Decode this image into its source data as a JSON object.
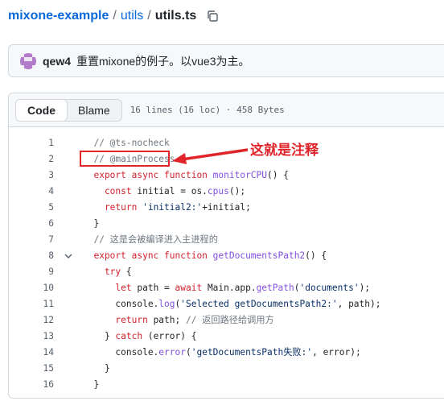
{
  "breadcrumb": {
    "repo": "mixone-example",
    "sep1": "/",
    "folder": "utils",
    "sep2": "/",
    "file": "utils.ts"
  },
  "commit": {
    "author": "qew4",
    "message": "重置mixone的例子。以vue3为主。"
  },
  "file_header": {
    "tab_code": "Code",
    "tab_blame": "Blame",
    "meta": "16 lines (16 loc) · 458 Bytes"
  },
  "code_lines": [
    {
      "n": "1",
      "tokens": [
        {
          "t": "  // @ts-nocheck",
          "c": "c"
        }
      ]
    },
    {
      "n": "2",
      "tokens": [
        {
          "t": "  // @mainProcess",
          "c": "c"
        }
      ]
    },
    {
      "n": "3",
      "tokens": [
        {
          "t": "  export async function ",
          "c": "k"
        },
        {
          "t": "monitorCPU",
          "c": "f"
        },
        {
          "t": "() {",
          "c": "v"
        }
      ]
    },
    {
      "n": "4",
      "tokens": [
        {
          "t": "    const ",
          "c": "k"
        },
        {
          "t": "initial = os.",
          "c": "v"
        },
        {
          "t": "cpus",
          "c": "f"
        },
        {
          "t": "();",
          "c": "v"
        }
      ]
    },
    {
      "n": "5",
      "tokens": [
        {
          "t": "    return ",
          "c": "k"
        },
        {
          "t": "'initial2:'",
          "c": "s"
        },
        {
          "t": "+initial;",
          "c": "v"
        }
      ]
    },
    {
      "n": "6",
      "tokens": [
        {
          "t": "  }",
          "c": "v"
        }
      ]
    },
    {
      "n": "7",
      "tokens": [
        {
          "t": "  // 这是会被编译进入主进程的",
          "c": "c"
        }
      ]
    },
    {
      "n": "8",
      "fold": true,
      "tokens": [
        {
          "t": "  export async function ",
          "c": "k"
        },
        {
          "t": "getDocumentsPath2",
          "c": "f"
        },
        {
          "t": "() {",
          "c": "v"
        }
      ]
    },
    {
      "n": "9",
      "tokens": [
        {
          "t": "    try ",
          "c": "k"
        },
        {
          "t": "{",
          "c": "v"
        }
      ]
    },
    {
      "n": "10",
      "tokens": [
        {
          "t": "      let ",
          "c": "k"
        },
        {
          "t": "path = ",
          "c": "v"
        },
        {
          "t": "await ",
          "c": "k"
        },
        {
          "t": "Main.app.",
          "c": "v"
        },
        {
          "t": "getPath",
          "c": "f"
        },
        {
          "t": "(",
          "c": "v"
        },
        {
          "t": "'documents'",
          "c": "s"
        },
        {
          "t": ");",
          "c": "v"
        }
      ]
    },
    {
      "n": "11",
      "tokens": [
        {
          "t": "      console.",
          "c": "v"
        },
        {
          "t": "log",
          "c": "f"
        },
        {
          "t": "(",
          "c": "v"
        },
        {
          "t": "'Selected getDocumentsPath2:'",
          "c": "s"
        },
        {
          "t": ", path);",
          "c": "v"
        }
      ]
    },
    {
      "n": "12",
      "tokens": [
        {
          "t": "      return ",
          "c": "k"
        },
        {
          "t": "path; ",
          "c": "v"
        },
        {
          "t": "// 返回路径给调用方",
          "c": "c"
        }
      ]
    },
    {
      "n": "13",
      "tokens": [
        {
          "t": "    } ",
          "c": "v"
        },
        {
          "t": "catch ",
          "c": "k"
        },
        {
          "t": "(error) {",
          "c": "v"
        }
      ]
    },
    {
      "n": "14",
      "tokens": [
        {
          "t": "      console.",
          "c": "v"
        },
        {
          "t": "error",
          "c": "f"
        },
        {
          "t": "(",
          "c": "v"
        },
        {
          "t": "'getDocumentsPath失败:'",
          "c": "s"
        },
        {
          "t": ", error);",
          "c": "v"
        }
      ]
    },
    {
      "n": "15",
      "tokens": [
        {
          "t": "    }",
          "c": "v"
        }
      ]
    },
    {
      "n": "16",
      "tokens": [
        {
          "t": "  }",
          "c": "v"
        }
      ]
    }
  ],
  "annotation": {
    "text": "这就是注释",
    "color": "#e0242a"
  },
  "icons": {
    "copy": "copy-icon",
    "fold": "chevron-down-icon",
    "avatar": "identicon-avatar"
  },
  "colors": {
    "link": "#0969da",
    "keyword": "#cf222e",
    "function": "#8250df",
    "string": "#0a3069",
    "comment": "#6e7781"
  }
}
